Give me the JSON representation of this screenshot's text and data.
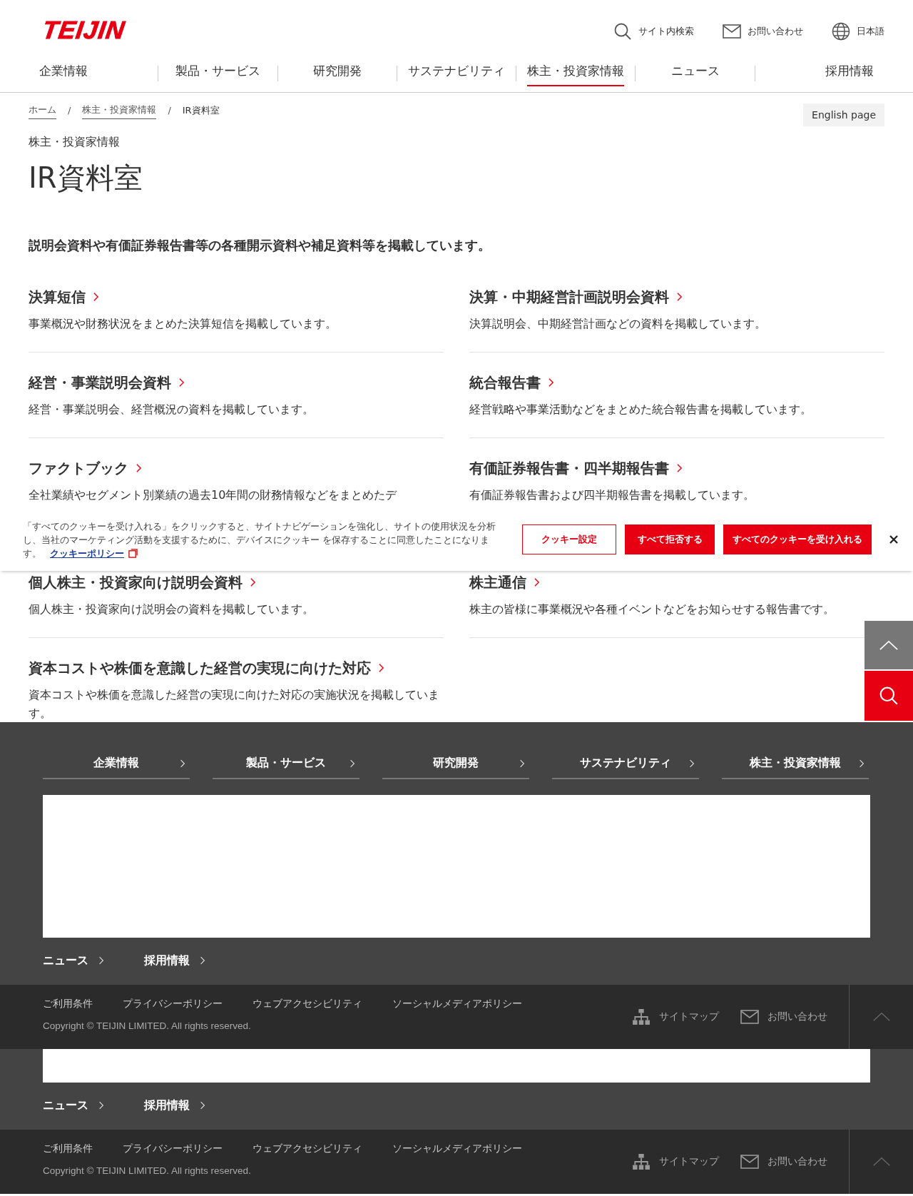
{
  "header": {
    "logo": "TEIJIN",
    "utility_links": [
      {
        "label": "サイト内検索",
        "kind": "search"
      },
      {
        "label": "お問い合わせ",
        "kind": "mail"
      },
      {
        "label": "日本語",
        "kind": "globe"
      }
    ],
    "nav": [
      {
        "label": "企業情報",
        "selected": false
      },
      {
        "label": "製品・サービス",
        "selected": false
      },
      {
        "label": "研究開発",
        "selected": false
      },
      {
        "label": "サステナビリティ",
        "selected": false
      },
      {
        "label": "株主・投資家情報",
        "selected": true
      },
      {
        "label": "ニュース",
        "selected": false
      },
      {
        "label": "採用情報",
        "selected": false
      }
    ]
  },
  "breadcrumb": [
    {
      "label": "ホーム",
      "link": true
    },
    {
      "label": "株主・投資家情報",
      "link": true
    },
    {
      "label": "IR資料室",
      "link": false
    }
  ],
  "breadcrumb_separator": "/",
  "english_button": "English page",
  "section_label": "株主・投資家情報",
  "title": "IR資料室",
  "lead": "説明会資料や有価証券報告書等の各種開示資料や補足資料等を掲載しています。",
  "cards": [
    {
      "title": "決算短信",
      "description": "事業概況や財務状況をまとめた決算短信を掲載しています。"
    },
    {
      "title": "決算・中期経営計画説明会資料",
      "description": "決算説明会、中期経営計画などの資料を掲載しています。"
    },
    {
      "title": "経営・事業説明会資料",
      "description": "経営・事業説明会、経営概況の資料を掲載しています。"
    },
    {
      "title": "統合報告書",
      "description": "経営戦略や事業活動などをまとめた統合報告書を掲載しています。"
    },
    {
      "title": "ファクトブック",
      "description": "全社業績やセグメント別業績の過去10年間の財務情報などをまとめたデ"
    },
    {
      "title": "有価証券報告書・四半期報告書",
      "description": "有価証券報告書および四半期報告書を掲載しています。"
    },
    {
      "title": "個人株主・投資家向け説明会資料",
      "description": "個人株主・投資家向け説明会の資料を掲載しています。"
    },
    {
      "title": "株主通信",
      "description": "株主の皆様に事業概況や各種イベントなどをお知らせする報告書です。"
    },
    {
      "title": "資本コストや株価を意識した経営の実現に向けた対応",
      "description": "資本コストや株価を意識した経営の実現に向けた対応の実施状況を掲載しています。"
    }
  ],
  "cookie_banner": {
    "text": "「すべてのクッキーを受け入れる」をクリックすると、サイトナビゲーションを強化し、サイトの使用状況を分析し、当社のマーケティング活動を支援するために、デバイスにクッキー を保存することに同意したことになります。",
    "link": "クッキーポリシー",
    "buttons": [
      {
        "label": "クッキー設定",
        "kind": "outline"
      },
      {
        "label": "すべて拒否する",
        "kind": "solid"
      },
      {
        "label": "すべてのクッキーを受け入れる",
        "kind": "solid"
      }
    ]
  },
  "footer_nav": [
    "企業情報",
    "製品・サービス",
    "研究開発",
    "サステナビリティ",
    "株主・投資家情報"
  ],
  "footer_sections": [
    {
      "sub_links": [
        "ニュース",
        "採用情報"
      ],
      "legal_links": [
        "ご利用条件",
        "プライバシーポリシー",
        "ウェブアクセシビリティ",
        "ソーシャルメディアポリシー"
      ],
      "copyright": "Copyright © TEIJIN LIMITED. All rights reserved.",
      "utility": [
        {
          "label": "サイトマップ",
          "kind": "sitemap"
        },
        {
          "label": "お問い合わせ",
          "kind": "mail"
        }
      ]
    },
    {
      "sub_links": [
        "ニュース",
        "採用情報"
      ],
      "legal_links": [
        "ご利用条件",
        "プライバシーポリシー",
        "ウェブアクセシビリティ",
        "ソーシャルメディアポリシー"
      ],
      "copyright": "Copyright © TEIJIN LIMITED. All rights reserved.",
      "utility": [
        {
          "label": "サイトマップ",
          "kind": "sitemap"
        },
        {
          "label": "お問い合わせ",
          "kind": "mail"
        }
      ]
    }
  ]
}
